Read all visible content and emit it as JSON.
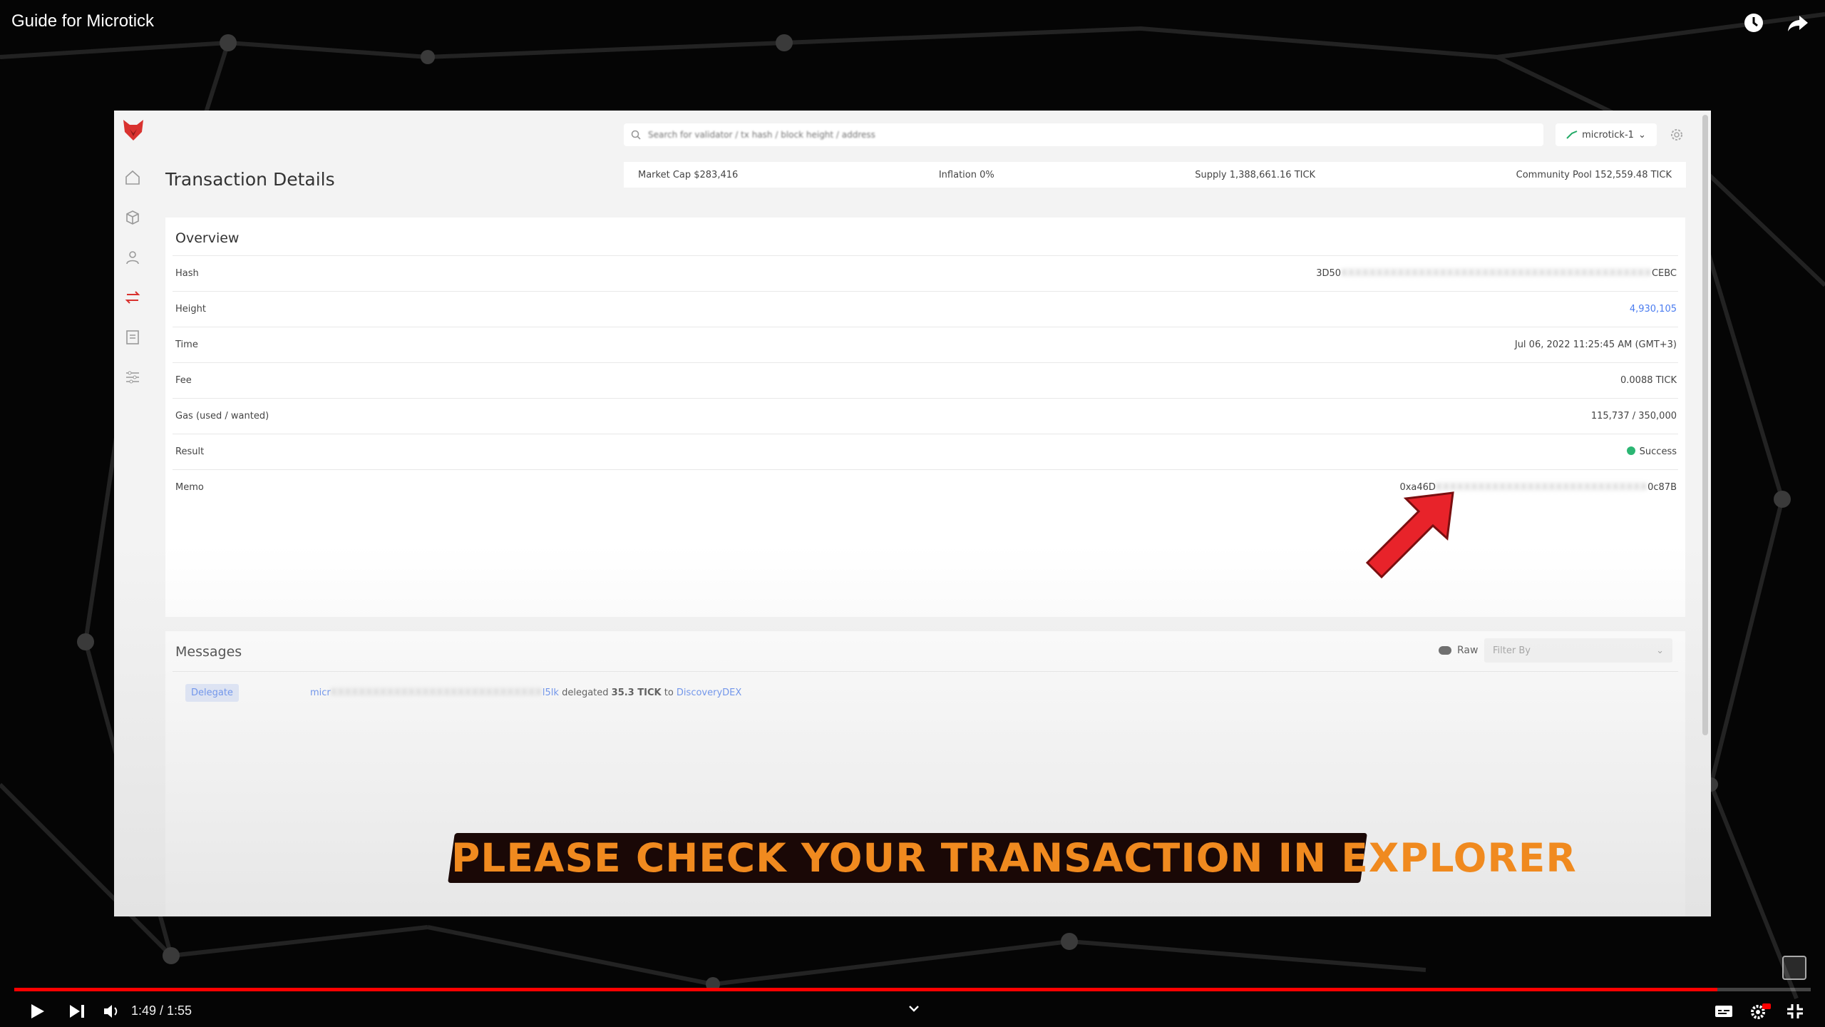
{
  "video": {
    "title": "Guide for Microtick",
    "time": "1:49 / 1:55",
    "progress": 0.948,
    "caption": "PLEASE CHECK YOUR TRANSACTION IN EXPLORER",
    "accent": "#ff0000"
  },
  "explorer": {
    "search_placeholder": "Search for validator / tx hash / block height / address",
    "network": "microtick-1",
    "page_title": "Transaction Details",
    "stats": [
      "Market Cap  $283,416",
      "Inflation  0%",
      "Supply  1,388,661.16 TICK",
      "Community Pool  152,559.48 TICK"
    ],
    "overview": {
      "title": "Overview",
      "rows": [
        {
          "label": "Hash",
          "prefix": "3D50",
          "hidden": "XXXXXXXXXXXXXXXXXXXXXXXXXXXXXXXXXXXXXXXXXXXX",
          "suffix": "CEBC"
        },
        {
          "label": "Height",
          "value": "4,930,105"
        },
        {
          "label": "Time",
          "value": "Jul 06, 2022 11:25:45 AM (GMT+3)"
        },
        {
          "label": "Fee",
          "value": "0.0088 TICK"
        },
        {
          "label": "Gas (used / wanted)",
          "value": "115,737 / 350,000"
        },
        {
          "label": "Result",
          "value": "Success"
        },
        {
          "label": "Memo",
          "prefix": "0xa46D",
          "hidden": "XXXXXXXXXXXXXXXXXXXXXXXXXXXXXX",
          "suffix": "0c87B"
        }
      ]
    },
    "messages": {
      "title": "Messages",
      "raw_label": "Raw",
      "filter_placeholder": "Filter By",
      "badge": "Delegate",
      "sender_prefix": "micr",
      "sender_hidden": "XXXXXXXXXXXXXXXXXXXXXXXXXXXXXX",
      "sender_suffix": "l5lk",
      "verb": "delegated",
      "amount": "35.3 TICK",
      "to": "to",
      "validator": "DiscoveryDEX"
    }
  }
}
